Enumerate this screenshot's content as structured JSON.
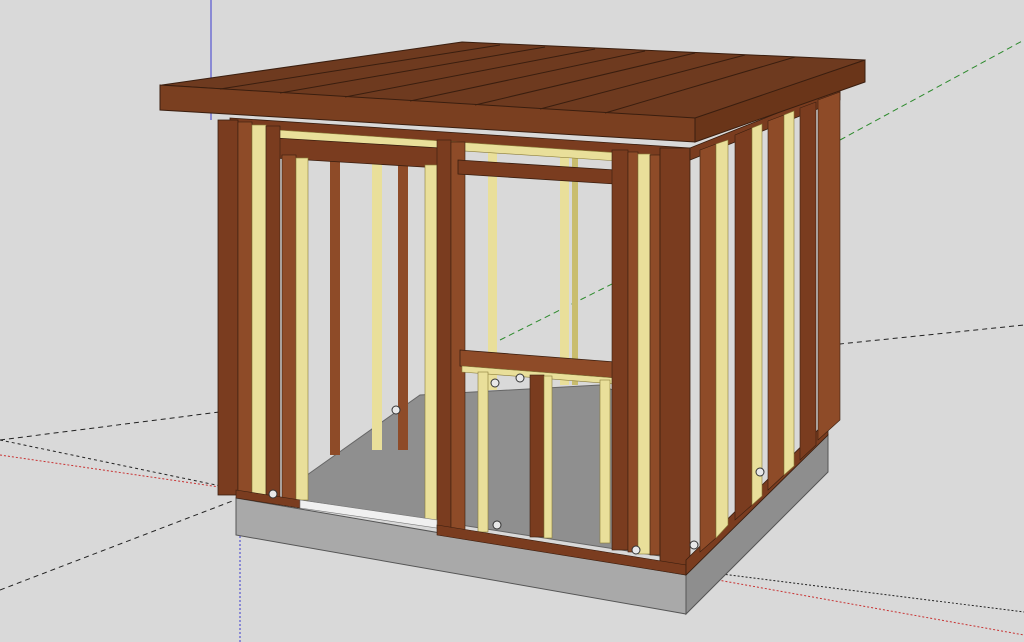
{
  "app": {
    "viewport_label": "",
    "background_color": "#d9d9d9"
  },
  "colors": {
    "roof_top": "#6e3a1f",
    "roof_edge": "#7a3f20",
    "roof_line": "#3a1e0f",
    "stud_brown": "#7a3c1f",
    "stud_brown_light": "#8e4b28",
    "stud_yellow": "#e9df9a",
    "stud_yellow_dark": "#c9bd6e",
    "floor": "#8f8f8f",
    "foundation_front": "#a9a9a9",
    "foundation_side": "#8e8e8e",
    "axis_red": "#c83232",
    "axis_green": "#2c8a2c",
    "axis_blue": "#3a3ad0",
    "axis_black": "#222222"
  },
  "axes": {
    "red": "red-axis",
    "green": "green-axis",
    "blue": "blue-axis"
  },
  "model": {
    "name": "shed-frame",
    "parts": [
      "roof",
      "front-wall",
      "right-wall",
      "left-wall",
      "back-wall",
      "floor",
      "foundation",
      "door-opening",
      "window-opening",
      "anchor-bolts"
    ]
  }
}
